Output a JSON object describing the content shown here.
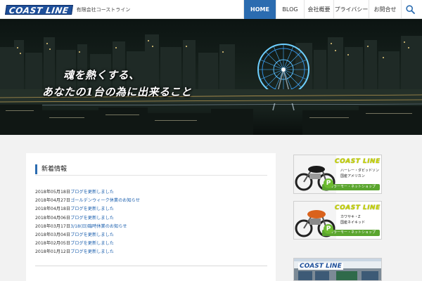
{
  "header": {
    "logo_text": "COAST LINE",
    "company_name": "有限会社コーストライン",
    "nav": [
      {
        "label": "HOME",
        "active": true
      },
      {
        "label": "BLOG",
        "active": false
      },
      {
        "label": "会社概要",
        "active": false
      },
      {
        "label": "プライバシー",
        "active": false
      },
      {
        "label": "お問合せ",
        "active": false
      }
    ],
    "search_icon": "search-icon"
  },
  "hero": {
    "line1": "魂を熱くする、",
    "line2": "あなたの1台の為に出来ること"
  },
  "news": {
    "title": "新着情報",
    "items": [
      {
        "date": "2018年05月18日",
        "text": "ブログを更新しました"
      },
      {
        "date": "2018年04月27日",
        "text": "ゴールデンウィーク休業のお知らせ"
      },
      {
        "date": "2018年04月18日",
        "text": "ブログを更新しました"
      },
      {
        "date": "2018年04月06日",
        "text": "ブログを更新しました"
      },
      {
        "date": "2018年03月17日",
        "text": "3/18(日)臨時休業のお知らせ"
      },
      {
        "date": "2018年03月04日",
        "text": "ブログを更新しました"
      },
      {
        "date": "2018年02月05日",
        "text": "ブログを更新しました"
      },
      {
        "date": "2018年01月12日",
        "text": "ブログを更新しました"
      }
    ]
  },
  "banners": [
    {
      "title": "COAST LINE",
      "sub1": "ハーレー・ダビッドソン",
      "sub2": "国産アメリカン",
      "cta": "カラーモー・ネットショップ"
    },
    {
      "title": "COAST LINE",
      "sub1": "カワサキ・Z",
      "sub2": "国産ネイキッド",
      "cta": "カラーモー・ネットショップ"
    },
    {
      "sign": "COAST LINE"
    }
  ],
  "colors": {
    "accent": "#2b6cb0",
    "link": "#1b5fae",
    "banner_green": "#5aa52e",
    "banner_title": "#c8d400"
  }
}
